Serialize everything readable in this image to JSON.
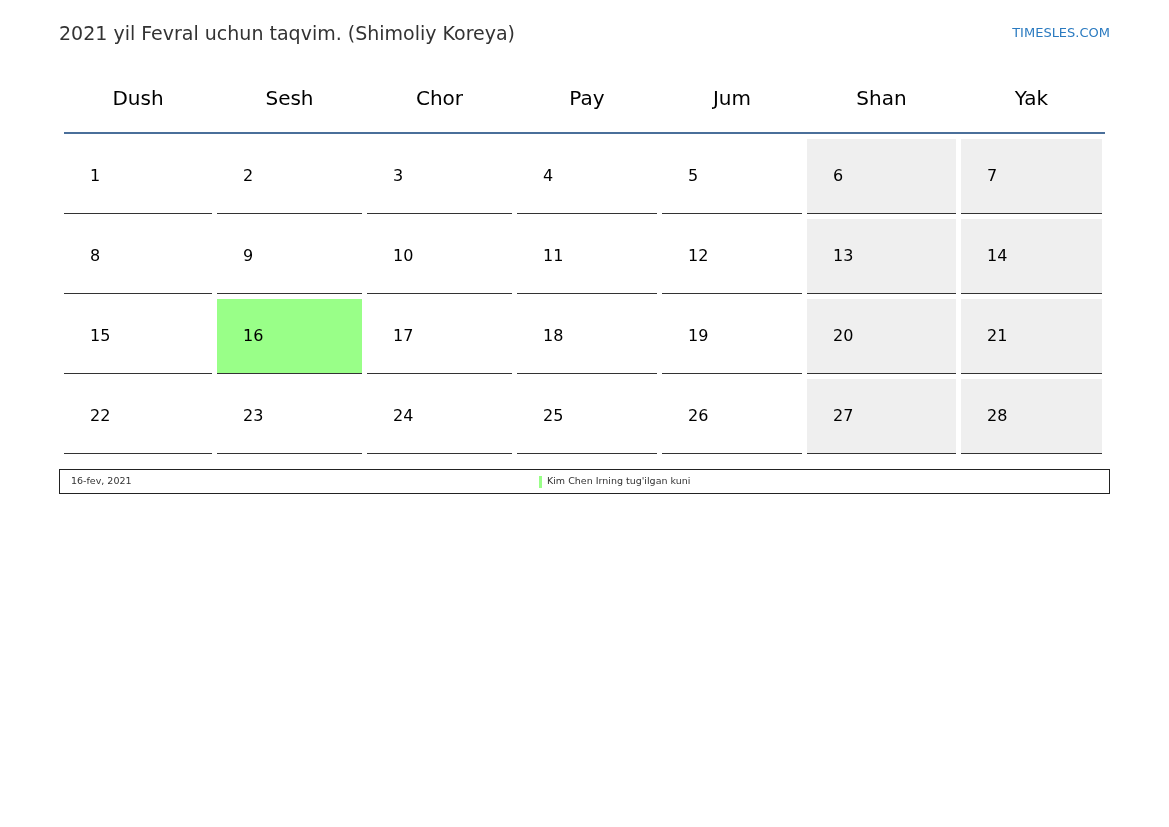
{
  "title": "2021 yil Fevral uchun taqvim. (Shimoliy Koreya)",
  "site_link": "TIMESLES.COM",
  "weekdays": [
    "Dush",
    "Sesh",
    "Chor",
    "Pay",
    "Jum",
    "Shan",
    "Yak"
  ],
  "weeks": [
    [
      {
        "day": "1",
        "kind": "workday"
      },
      {
        "day": "2",
        "kind": "workday"
      },
      {
        "day": "3",
        "kind": "workday"
      },
      {
        "day": "4",
        "kind": "workday"
      },
      {
        "day": "5",
        "kind": "workday"
      },
      {
        "day": "6",
        "kind": "weekend"
      },
      {
        "day": "7",
        "kind": "weekend"
      }
    ],
    [
      {
        "day": "8",
        "kind": "workday"
      },
      {
        "day": "9",
        "kind": "workday"
      },
      {
        "day": "10",
        "kind": "workday"
      },
      {
        "day": "11",
        "kind": "workday"
      },
      {
        "day": "12",
        "kind": "workday"
      },
      {
        "day": "13",
        "kind": "weekend"
      },
      {
        "day": "14",
        "kind": "weekend"
      }
    ],
    [
      {
        "day": "15",
        "kind": "workday"
      },
      {
        "day": "16",
        "kind": "holiday",
        "color": "#99ff88"
      },
      {
        "day": "17",
        "kind": "workday"
      },
      {
        "day": "18",
        "kind": "workday"
      },
      {
        "day": "19",
        "kind": "workday"
      },
      {
        "day": "20",
        "kind": "weekend"
      },
      {
        "day": "21",
        "kind": "weekend"
      }
    ],
    [
      {
        "day": "22",
        "kind": "workday"
      },
      {
        "day": "23",
        "kind": "workday"
      },
      {
        "day": "24",
        "kind": "workday"
      },
      {
        "day": "25",
        "kind": "workday"
      },
      {
        "day": "26",
        "kind": "workday"
      },
      {
        "day": "27",
        "kind": "weekend"
      },
      {
        "day": "28",
        "kind": "weekend"
      }
    ]
  ],
  "holidays": [
    {
      "date": "16-fev, 2021",
      "name": "Kim Chen Irning tug'ilgan kuni",
      "color": "#99ff88"
    }
  ]
}
